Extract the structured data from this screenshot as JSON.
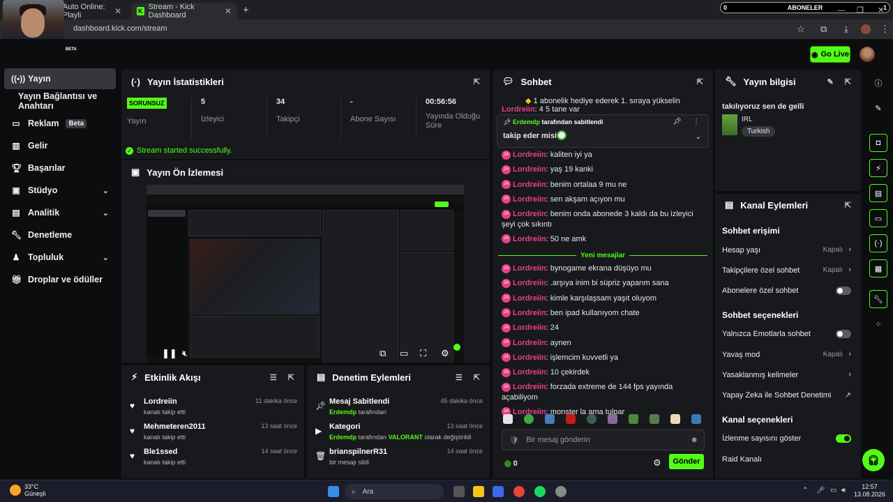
{
  "browser": {
    "tabs": [
      {
        "label": "Auto Online: Playli"
      },
      {
        "label": "Stream - Kick Dashboard"
      }
    ],
    "url": "dashboard.kick.com/stream",
    "subscriber_bar": {
      "left": "0",
      "label": "ABONELER",
      "right": "1"
    }
  },
  "topbar": {
    "go_live": "Go Live",
    "beta": "BETA"
  },
  "sidebar": {
    "items": [
      {
        "label": "Yayın",
        "icon": "broadcast-icon"
      },
      {
        "label": "Yayın Bağlantısı ve Anahtarı"
      },
      {
        "label": "Reklam",
        "badge": "Beta",
        "icon": "ad-icon"
      },
      {
        "label": "Gelir",
        "icon": "chart-icon"
      },
      {
        "label": "Başarılar",
        "icon": "trophy-icon"
      },
      {
        "label": "Stüdyo",
        "icon": "studio-icon"
      },
      {
        "label": "Analitik",
        "icon": "analytics-icon"
      },
      {
        "label": "Denetleme",
        "icon": "wrench-icon"
      },
      {
        "label": "Topluluk",
        "icon": "community-icon"
      },
      {
        "label": "Droplar ve ödüller",
        "icon": "gift-icon"
      }
    ]
  },
  "stats": {
    "title": "Yayın İstatistikleri",
    "cols": [
      {
        "value": "SORUNSUZ",
        "label": "Yayın"
      },
      {
        "value": "5",
        "label": "İzleyici"
      },
      {
        "value": "34",
        "label": "Takipçi"
      },
      {
        "value": "-",
        "label": "Abone Sayısı"
      },
      {
        "value": "00:56:56",
        "label": "Yayında Olduğu Süre"
      }
    ],
    "status": "Stream started successfully."
  },
  "preview": {
    "title": "Yayın Ön İzlemesi"
  },
  "activity": {
    "title": "Etkinlik Akışı",
    "items": [
      {
        "name": "Lordreiin",
        "sub": "kanalı takip etti",
        "time": "11 dakika önce"
      },
      {
        "name": "Mehmeteren2011",
        "sub": "kanalı takip etti",
        "time": "13 saat önce"
      },
      {
        "name": "Ble1ssed",
        "sub": "kanalı takip etti",
        "time": "14 saat önce"
      }
    ]
  },
  "moderation": {
    "title": "Denetim Eylemleri",
    "items": [
      {
        "name": "Mesaj Sabitlendi",
        "user": "Erdemdp",
        "sub": " tarafından",
        "time": "45 dakika önce"
      },
      {
        "name": "Kategori",
        "user": "Erdemdp",
        "sub": " tarafından ",
        "cat": "VALORANT",
        "sub2": " olarak değiştirildi",
        "time": "13 saat önce"
      },
      {
        "name": "brianspilnerR31",
        "sub": "bir mesajı sildi",
        "time": "14 saat önce"
      }
    ]
  },
  "chat": {
    "title": "Sohbet",
    "gift_banner": "1 abonelik hediye ederek 1. sıraya yükselin",
    "pinned_by": "Erdemdp",
    "pinned_suffix": " tarafından sabitlendi",
    "pinned_text": "takip eder misin",
    "behind_text": "4 5 tane var",
    "messages_before": [
      {
        "user": "Lordreiin",
        "text": "kaliten iyi ya"
      },
      {
        "user": "Lordreiin",
        "text": "yaş 19 kanki"
      },
      {
        "user": "Lordreiin",
        "text": "benim ortalaa 9 mu ne"
      },
      {
        "user": "Lordreiin",
        "text": "sen akşam açıyon mu"
      },
      {
        "user": "Lordreiin",
        "text": "benim onda abonede 3 kaldı da bu izleyici şeyi çok sıkıntı"
      },
      {
        "user": "Lordreiin",
        "text": "50 ne amk"
      }
    ],
    "new_messages": "Yeni mesajlar",
    "messages_after": [
      {
        "user": "Lordreiin",
        "text": "bynogame ekrana düşüyo mu"
      },
      {
        "user": "Lordreiin",
        "text": ".arşıya inim bi süpriz yaparım sana"
      },
      {
        "user": "Lordreiin",
        "text": "kimle karşılaşsam yaşıt oluyom"
      },
      {
        "user": "Lordreiin",
        "text": "ben ipad kullanıyom chate"
      },
      {
        "user": "Lordreiin",
        "text": "24"
      },
      {
        "user": "Lordreiin",
        "text": "aynen"
      },
      {
        "user": "Lordreiin",
        "text": "işlemcim kuvvetli ya"
      },
      {
        "user": "Lordreiin",
        "text": "10 çekirdek"
      },
      {
        "user": "Lordreiin",
        "text": "forzada extreme de 144 fps yayında açabiliyom"
      },
      {
        "user": "Lordreiin",
        "text": "monster la ama tulpar"
      }
    ],
    "placeholder": "Bir mesaj gönderin",
    "points": "0",
    "send": "Gönder"
  },
  "info": {
    "title": "Yayın bilgisi",
    "stream_title": "takılıyoruz sen de gelli",
    "category": "IRL",
    "tag": "Turkish"
  },
  "actions": {
    "title": "Kanal Eylemleri",
    "h1": "Sohbet erişimi",
    "hesap": "Hesap yaşı",
    "hesap_val": "Kapalı",
    "takipci": "Takipçilere özel sohbet",
    "takipci_val": "Kapalı",
    "abone": "Abonelere özel sohbet",
    "h2": "Sohbet seçenekleri",
    "emote": "Yalnızca Emotlarla sohbet",
    "yavas": "Yavaş mod",
    "yavas_val": "Kapalı",
    "yasak": "Yasaklanmış kelimeler",
    "ai": "Yapay Zeka ile Sohbet Denetimi",
    "h3": "Kanal seçenekleri",
    "izlenme": "İzlenme sayısını göster",
    "raid": "Raid Kanalı"
  },
  "taskbar": {
    "temp": "33°C",
    "weather": "Güneşli",
    "search": "Ara",
    "time": "12:57",
    "date": "13.08.2026"
  }
}
